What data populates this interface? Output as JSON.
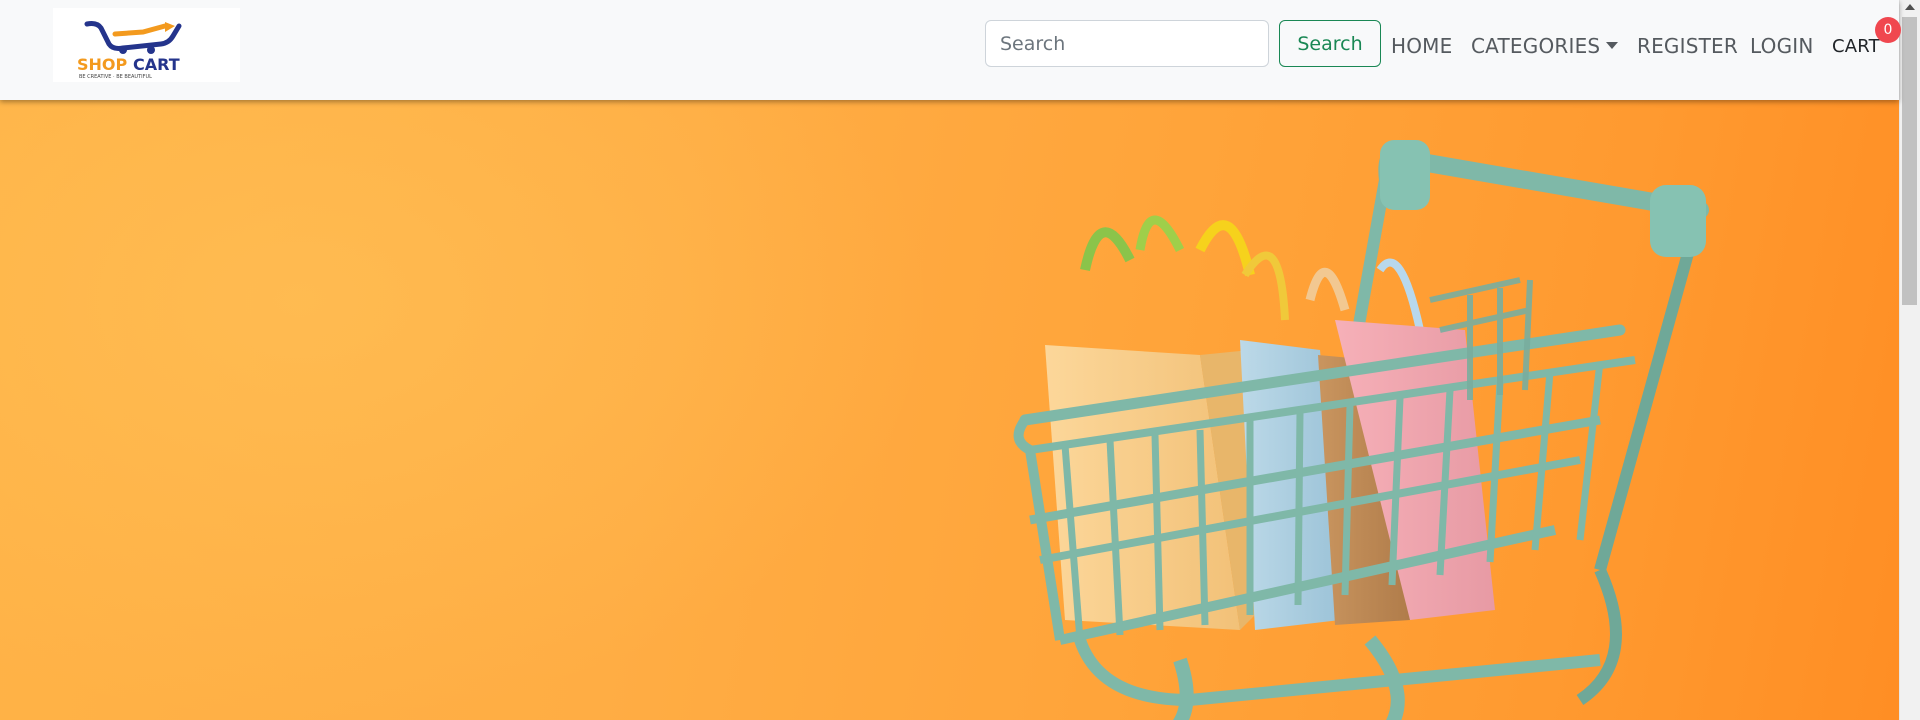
{
  "navbar": {
    "brand": {
      "logo_icon": "shopping-cart-logo",
      "logo_text_primary": "SHOP",
      "logo_text_secondary": "CART",
      "tagline": "BE CREATIVE · BE BEAUTIFUL"
    },
    "search": {
      "placeholder": "Search",
      "value": "",
      "button_label": "Search"
    },
    "links": {
      "home": "HOME",
      "categories": "CATEGORIES",
      "register": "REGISTER",
      "login": "LOGIN",
      "cart": "CART"
    },
    "cart_count": "0"
  },
  "hero": {
    "image": "shopping-cart-with-paper-bags",
    "background_color": "#ffa43a"
  },
  "colors": {
    "accent_green": "#198754",
    "badge_red": "#f0474f",
    "navbar_bg": "#f8f9fa",
    "cart_teal": "#7fb8a8"
  }
}
